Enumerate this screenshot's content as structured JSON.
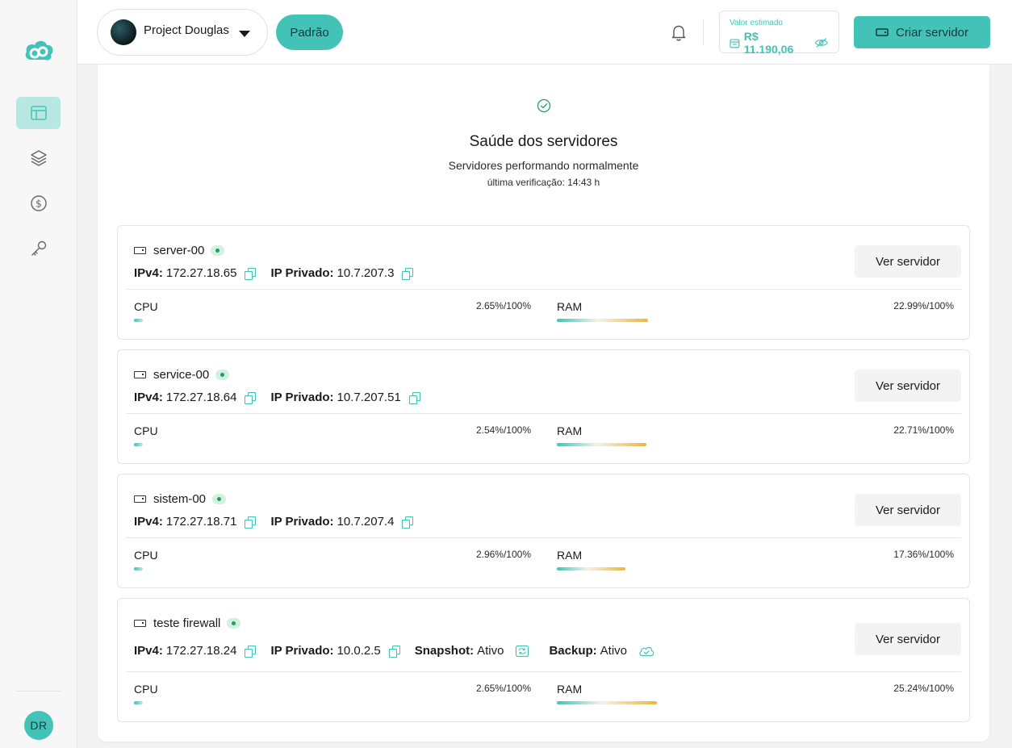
{
  "sidebar": {
    "items": [
      {
        "name": "dashboard",
        "active": true
      },
      {
        "name": "layers",
        "active": false
      },
      {
        "name": "billing",
        "active": false
      },
      {
        "name": "keys",
        "active": false
      }
    ],
    "avatar_initials": "DR"
  },
  "header": {
    "project_name": "Project Douglas",
    "badge": "Padrão",
    "estimate_label": "Valor estimado",
    "estimate_value": "R$ 11.190,06",
    "create_button": "Criar servidor"
  },
  "health": {
    "title": "Saúde dos servidores",
    "subtitle": "Servidores performando normalmente",
    "last_check": "última verificação: 14:43 h"
  },
  "labels": {
    "ipv4": "IPv4:",
    "private_ip": "IP Privado:",
    "snapshot": "Snapshot:",
    "backup": "Backup:",
    "cpu": "CPU",
    "ram": "RAM",
    "view_server": "Ver servidor"
  },
  "servers": [
    {
      "name": "server-00",
      "ipv4": "172.27.18.65",
      "private_ip": "10.7.207.3",
      "cpu": "2.65%/100%",
      "cpu_pct": 2.65,
      "ram": "22.99%/100%",
      "ram_pct": 22.99
    },
    {
      "name": "service-00",
      "ipv4": "172.27.18.64",
      "private_ip": "10.7.207.51",
      "cpu": "2.54%/100%",
      "cpu_pct": 2.54,
      "ram": "22.71%/100%",
      "ram_pct": 22.71
    },
    {
      "name": "sistem-00",
      "ipv4": "172.27.18.71",
      "private_ip": "10.7.207.4",
      "cpu": "2.96%/100%",
      "cpu_pct": 2.96,
      "ram": "17.36%/100%",
      "ram_pct": 17.36
    },
    {
      "name": "teste firewall",
      "ipv4": "172.27.18.24",
      "private_ip": "10.0.2.5",
      "snapshot": "Ativo",
      "backup": "Ativo",
      "cpu": "2.65%/100%",
      "cpu_pct": 2.65,
      "ram": "25.24%/100%",
      "ram_pct": 25.24
    }
  ],
  "colors": {
    "accent": "#43c3b7",
    "status_ok": "#1fa15e",
    "ram_bar_end": "#e8b73d"
  }
}
